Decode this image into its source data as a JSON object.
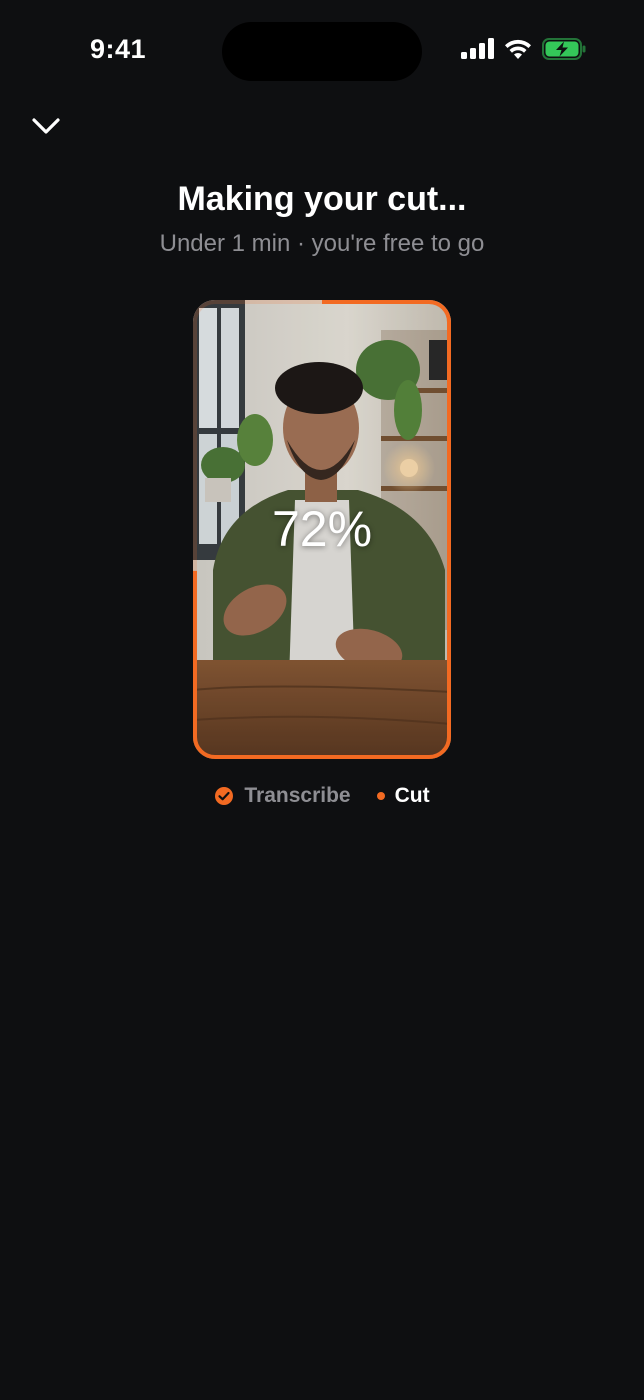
{
  "status_bar": {
    "time": "9:41",
    "icons": [
      "signal-icon",
      "wifi-icon",
      "battery-charging-icon"
    ]
  },
  "nav": {
    "dismiss_icon": "chevron-down-icon"
  },
  "header": {
    "title": "Making your cut...",
    "subtitle": "Under 1 min · you're free to go"
  },
  "preview": {
    "progress_percent_label": "72%",
    "progress_fraction": 0.72
  },
  "steps": [
    {
      "label": "Transcribe",
      "state": "done",
      "icon": "check-circle-icon"
    },
    {
      "label": "Cut",
      "state": "active",
      "icon": "dot-icon"
    }
  ],
  "colors": {
    "background": "#0e0f11",
    "accent": "#f26a22",
    "text_primary": "#ffffff",
    "text_secondary": "#8e8e93",
    "battery_green": "#34c759"
  }
}
